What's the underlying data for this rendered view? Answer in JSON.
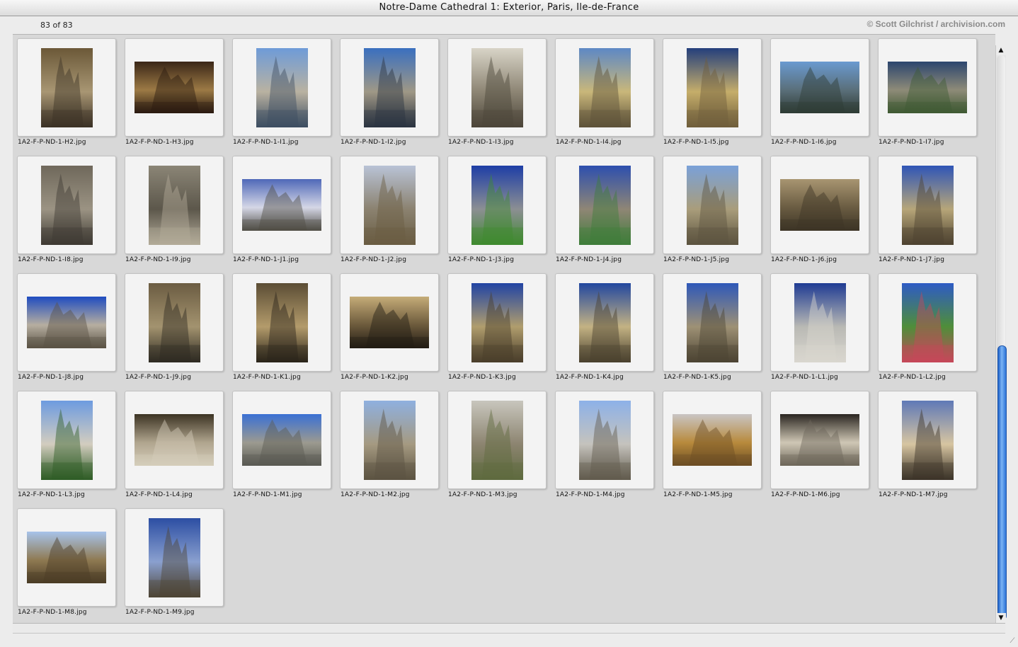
{
  "window": {
    "title": "Notre-Dame Cathedral 1: Exterior, Paris, Ile-de-France",
    "count": "83 of 83",
    "credit": "© Scott Gilchrist / archivision.com"
  },
  "scrollbar": {
    "up_glyph": "▲",
    "down_glyph": "▼",
    "position": 0.9
  },
  "resize_glyph": "⟋",
  "items": [
    {
      "file": "1A2-F-P-ND-1-H2.jpg",
      "orient": "portrait",
      "colors": [
        "#6b5838",
        "#a89673",
        "#3b3226"
      ]
    },
    {
      "file": "1A2-F-P-ND-1-H3.jpg",
      "orient": "landscape",
      "colors": [
        "#3a2617",
        "#9c7a45",
        "#2a1a10"
      ]
    },
    {
      "file": "1A2-F-P-ND-1-I1.jpg",
      "orient": "portrait",
      "colors": [
        "#6e9bd8",
        "#b9b2a1",
        "#3d4e62"
      ]
    },
    {
      "file": "1A2-F-P-ND-1-I2.jpg",
      "orient": "portrait",
      "colors": [
        "#3a6fbf",
        "#9f9886",
        "#2b3441"
      ]
    },
    {
      "file": "1A2-F-P-ND-1-I3.jpg",
      "orient": "portrait",
      "colors": [
        "#d8d4c7",
        "#8d8574",
        "#4c463a"
      ]
    },
    {
      "file": "1A2-F-P-ND-1-I4.jpg",
      "orient": "portrait",
      "colors": [
        "#5d88c5",
        "#c9b77a",
        "#5e523a"
      ]
    },
    {
      "file": "1A2-F-P-ND-1-I5.jpg",
      "orient": "portrait",
      "colors": [
        "#243f7c",
        "#c5ad6a",
        "#6f5e3b"
      ]
    },
    {
      "file": "1A2-F-P-ND-1-I6.jpg",
      "orient": "landscape",
      "colors": [
        "#6a9ad0",
        "#5a6f7a",
        "#2f3c35"
      ]
    },
    {
      "file": "1A2-F-P-ND-1-I7.jpg",
      "orient": "landscape",
      "colors": [
        "#2c456e",
        "#8e8b78",
        "#3f5a33"
      ]
    },
    {
      "file": "1A2-F-P-ND-1-I8.jpg",
      "orient": "portrait",
      "colors": [
        "#6f685b",
        "#9b9383",
        "#3e3a33"
      ]
    },
    {
      "file": "1A2-F-P-ND-1-I9.jpg",
      "orient": "portrait",
      "colors": [
        "#8b8576",
        "#5c574b",
        "#b3ab99"
      ]
    },
    {
      "file": "1A2-F-P-ND-1-J1.jpg",
      "orient": "landscape",
      "colors": [
        "#4f68b8",
        "#d5d7e6",
        "#4f4d45"
      ]
    },
    {
      "file": "1A2-F-P-ND-1-J2.jpg",
      "orient": "portrait",
      "colors": [
        "#b9c3d6",
        "#8b8270",
        "#6a5d43"
      ]
    },
    {
      "file": "1A2-F-P-ND-1-J3.jpg",
      "orient": "portrait",
      "colors": [
        "#1e3ea6",
        "#8c8f93",
        "#3f8a2f"
      ]
    },
    {
      "file": "1A2-F-P-ND-1-J4.jpg",
      "orient": "portrait",
      "colors": [
        "#2d4fae",
        "#8f8675",
        "#3f7d3a"
      ]
    },
    {
      "file": "1A2-F-P-ND-1-J5.jpg",
      "orient": "portrait",
      "colors": [
        "#7aa1d8",
        "#a99d7b",
        "#5d5440"
      ]
    },
    {
      "file": "1A2-F-P-ND-1-J6.jpg",
      "orient": "landscape",
      "colors": [
        "#a89571",
        "#6a5c42",
        "#3d3526"
      ]
    },
    {
      "file": "1A2-F-P-ND-1-J7.jpg",
      "orient": "portrait",
      "colors": [
        "#2f55b7",
        "#b7a679",
        "#4e4330"
      ]
    },
    {
      "file": "1A2-F-P-ND-1-J8.jpg",
      "orient": "landscape",
      "colors": [
        "#1f4cc0",
        "#b6aea0",
        "#5a5244"
      ]
    },
    {
      "file": "1A2-F-P-ND-1-J9.jpg",
      "orient": "portrait",
      "colors": [
        "#6b5c42",
        "#a3936f",
        "#2e2a22"
      ]
    },
    {
      "file": "1A2-F-P-ND-1-K1.jpg",
      "orient": "portrait",
      "colors": [
        "#5b4d35",
        "#b39b6b",
        "#2a241a"
      ]
    },
    {
      "file": "1A2-F-P-ND-1-K2.jpg",
      "orient": "landscape",
      "colors": [
        "#c5ac78",
        "#6c5a3c",
        "#221c14"
      ]
    },
    {
      "file": "1A2-F-P-ND-1-K3.jpg",
      "orient": "portrait",
      "colors": [
        "#2144a4",
        "#b09d6d",
        "#4a3e2b"
      ]
    },
    {
      "file": "1A2-F-P-ND-1-K4.jpg",
      "orient": "portrait",
      "colors": [
        "#22479f",
        "#c3b283",
        "#4a412f"
      ]
    },
    {
      "file": "1A2-F-P-ND-1-K5.jpg",
      "orient": "portrait",
      "colors": [
        "#2e58b9",
        "#9e9175",
        "#4c4433"
      ]
    },
    {
      "file": "1A2-F-P-ND-1-L1.jpg",
      "orient": "portrait",
      "colors": [
        "#1f3b93",
        "#b9b9b4",
        "#d9d6cf"
      ]
    },
    {
      "file": "1A2-F-P-ND-1-L2.jpg",
      "orient": "portrait",
      "colors": [
        "#2e5bc5",
        "#4f8e39",
        "#c7485a"
      ]
    },
    {
      "file": "1A2-F-P-ND-1-L3.jpg",
      "orient": "portrait",
      "colors": [
        "#6d9be0",
        "#d3cdbf",
        "#2f5d26"
      ]
    },
    {
      "file": "1A2-F-P-ND-1-L4.jpg",
      "orient": "landscape",
      "colors": [
        "#3c3323",
        "#b0a58e",
        "#d5cdbb"
      ]
    },
    {
      "file": "1A2-F-P-ND-1-M1.jpg",
      "orient": "landscape",
      "colors": [
        "#3a70d4",
        "#9c9a90",
        "#5a5a52"
      ]
    },
    {
      "file": "1A2-F-P-ND-1-M2.jpg",
      "orient": "portrait",
      "colors": [
        "#8fb0df",
        "#a59a81",
        "#5c5342"
      ]
    },
    {
      "file": "1A2-F-P-ND-1-M3.jpg",
      "orient": "portrait",
      "colors": [
        "#c8c6bd",
        "#8c8470",
        "#5f6b3f"
      ]
    },
    {
      "file": "1A2-F-P-ND-1-M4.jpg",
      "orient": "portrait",
      "colors": [
        "#8db1e8",
        "#c5c3bd",
        "#625b4d"
      ]
    },
    {
      "file": "1A2-F-P-ND-1-M5.jpg",
      "orient": "landscape",
      "colors": [
        "#c9c5c4",
        "#b88a3c",
        "#6c4e24"
      ]
    },
    {
      "file": "1A2-F-P-ND-1-M6.jpg",
      "orient": "landscape",
      "colors": [
        "#2a2520",
        "#cfc7b5",
        "#6d665a"
      ]
    },
    {
      "file": "1A2-F-P-ND-1-M7.jpg",
      "orient": "portrait",
      "colors": [
        "#5f79b7",
        "#d7c5a1",
        "#3c3429"
      ]
    },
    {
      "file": "1A2-F-P-ND-1-M8.jpg",
      "orient": "landscape",
      "colors": [
        "#a7c3ea",
        "#8f7a52",
        "#4b3c26"
      ]
    },
    {
      "file": "1A2-F-P-ND-1-M9.jpg",
      "orient": "portrait",
      "colors": [
        "#2c4ea3",
        "#8aa0cf",
        "#4d4435"
      ]
    }
  ]
}
